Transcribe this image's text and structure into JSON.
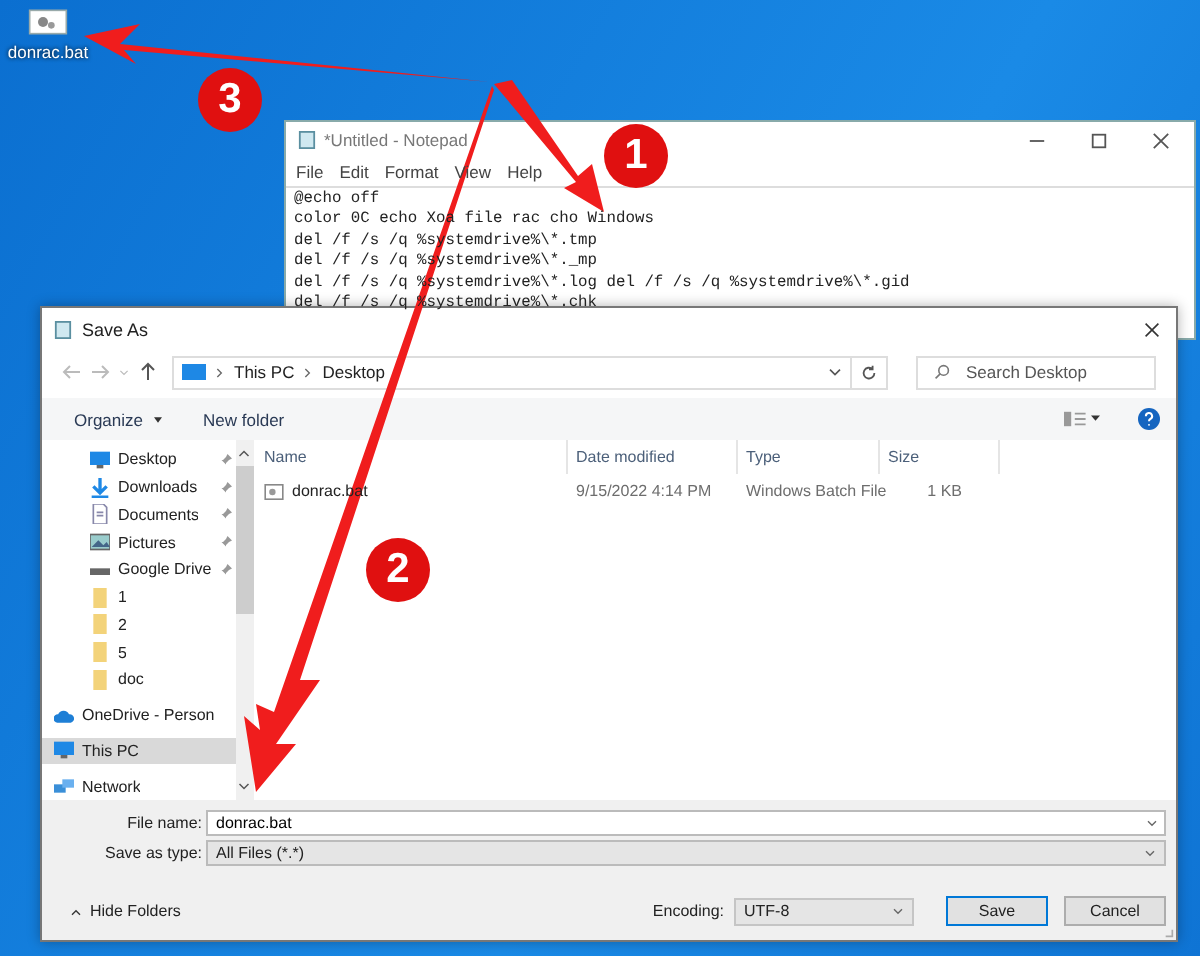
{
  "desktop": {
    "icons": [
      {
        "label": "donrac.bat"
      }
    ]
  },
  "notepad": {
    "title": "*Untitled - Notepad",
    "menu": [
      "File",
      "Edit",
      "Format",
      "View",
      "Help"
    ],
    "lines": [
      "@echo off",
      "color 0C echo Xoa file rac cho Windows",
      "del /f /s /q %systemdrive%\\*.tmp",
      "del /f /s /q %systemdrive%\\*._mp",
      "del /f /s /q %systemdrive%\\*.log del /f /s /q %systemdrive%\\*.gid",
      "del /f /s /q %systemdrive%\\*.chk"
    ]
  },
  "save_dialog": {
    "title": "Save As",
    "breadcrumb": [
      "This PC",
      "Desktop"
    ],
    "search": {
      "placeholder": "Search Desktop"
    },
    "organize": "Organize",
    "new_folder": "New folder",
    "sidebar": [
      {
        "label": "Desktop",
        "kind": "desktop",
        "pinned": true,
        "selected": false
      },
      {
        "label": "Downloads",
        "kind": "downloads",
        "pinned": true,
        "selected": false
      },
      {
        "label": "Documents",
        "kind": "documents",
        "pinned": true,
        "selected": false
      },
      {
        "label": "Pictures",
        "kind": "pictures",
        "pinned": true,
        "selected": false
      },
      {
        "label": "Google Drive",
        "kind": "drive",
        "pinned": true,
        "selected": false
      },
      {
        "label": "1",
        "kind": "folder",
        "pinned": false,
        "selected": false
      },
      {
        "label": "2",
        "kind": "folder",
        "pinned": false,
        "selected": false
      },
      {
        "label": "5",
        "kind": "folder",
        "pinned": false,
        "selected": false
      },
      {
        "label": "doc",
        "kind": "folder",
        "pinned": false,
        "selected": false
      },
      {
        "label": "OneDrive - Person",
        "kind": "cloud",
        "pinned": false,
        "selected": false
      },
      {
        "label": "This PC",
        "kind": "pc",
        "pinned": false,
        "selected": true
      },
      {
        "label": "Network",
        "kind": "network",
        "pinned": false,
        "selected": false
      }
    ],
    "columns": [
      "Name",
      "Date modified",
      "Type",
      "Size"
    ],
    "files": [
      {
        "name": "donrac.bat",
        "date": "9/15/2022 4:14 PM",
        "type": "Windows Batch File",
        "size": "1 KB"
      }
    ],
    "file_name_label": "File name:",
    "file_name": "donrac.bat",
    "save_as_type_label": "Save as type:",
    "save_as_type": "All Files (*.*)",
    "hide_folders": "Hide Folders",
    "encoding_label": "Encoding:",
    "encoding": "UTF-8",
    "buttons": [
      {
        "label": "Save",
        "default": true
      },
      {
        "label": "Cancel",
        "default": false
      }
    ]
  },
  "annotations": [
    {
      "number": "1"
    },
    {
      "number": "2"
    },
    {
      "number": "3"
    }
  ]
}
